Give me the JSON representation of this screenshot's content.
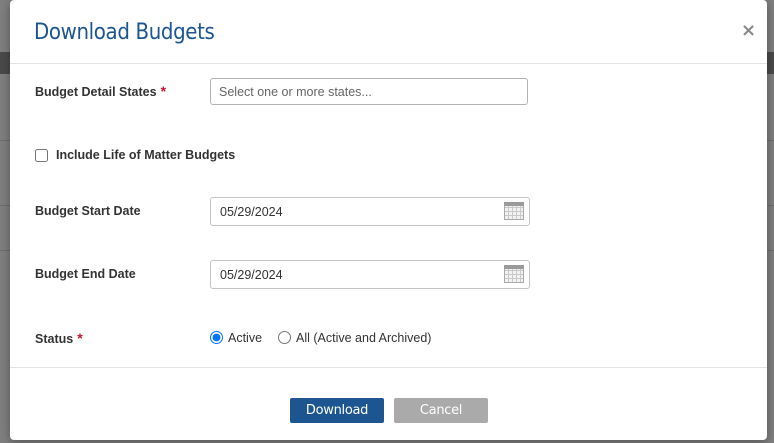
{
  "dialog": {
    "title": "Download Budgets",
    "close_label": "×"
  },
  "fields": {
    "detail_states": {
      "label": "Budget Detail States",
      "required_mark": "*",
      "placeholder": "Select one or more states..."
    },
    "life_of_matter": {
      "label": "Include Life of Matter Budgets",
      "checked": false
    },
    "start_date": {
      "label": "Budget Start Date",
      "value": "05/29/2024"
    },
    "end_date": {
      "label": "Budget End Date",
      "value": "05/29/2024"
    },
    "status": {
      "label": "Status",
      "required_mark": "*",
      "options": [
        {
          "label": "Active",
          "selected": true
        },
        {
          "label": "All (Active and Archived)",
          "selected": false
        }
      ]
    }
  },
  "footer": {
    "download_label": "Download",
    "cancel_label": "Cancel"
  },
  "colors": {
    "brand": "#1d5590",
    "required": "#c8102e",
    "secondary_button": "#aaaaaa"
  },
  "icons": {
    "calendar": "calendar-icon",
    "close": "close-icon"
  }
}
